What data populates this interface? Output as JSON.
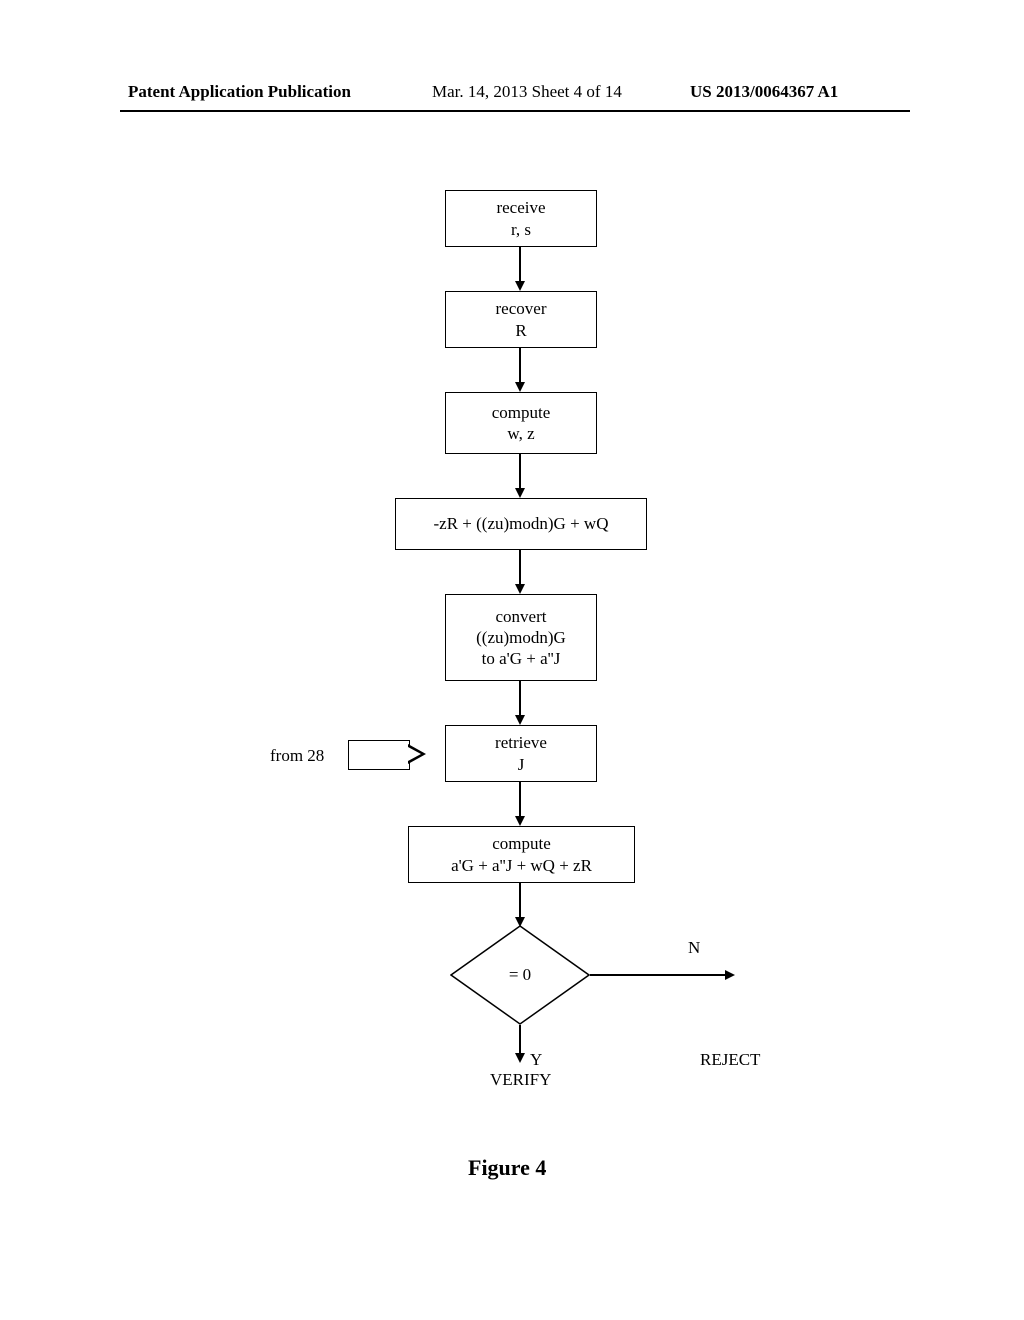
{
  "header": {
    "left": "Patent Application Publication",
    "mid": "Mar. 14, 2013  Sheet 4 of 14",
    "right": "US 2013/0064367 A1"
  },
  "flow": {
    "step1_l1": "receive",
    "step1_l2": "r, s",
    "step2_l1": "recover",
    "step2_l2": "R",
    "step3_l1": "compute",
    "step3_l2": "w, z",
    "step4": "-zR + ((zu)modn)G + wQ",
    "step5_l1": "convert",
    "step5_l2": "((zu)modn)G",
    "step5_l3": "to a'G + a''J",
    "step6_l1": "retrieve",
    "step6_l2": "J",
    "step7_l1": "compute",
    "step7_l2": "a'G + a''J + wQ + zR",
    "decision": "= 0",
    "from28_label": "from 28",
    "branch_no": "N",
    "branch_yes": "Y",
    "out_yes": "VERIFY",
    "out_no": "REJECT"
  },
  "caption": "Figure 4"
}
